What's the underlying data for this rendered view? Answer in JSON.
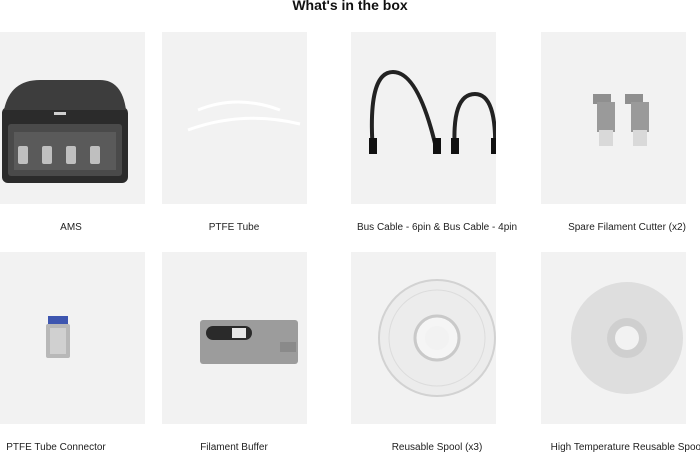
{
  "section": {
    "title": "What's in the box"
  },
  "items": [
    {
      "label": "AMS",
      "icon": "ams-unit-icon"
    },
    {
      "label": "PTFE Tube",
      "icon": "ptfe-tube-icon"
    },
    {
      "label": "Bus Cable - 6pin & Bus Cable - 4pin",
      "icon": "bus-cable-icon"
    },
    {
      "label": "Spare Filament Cutter (x2)",
      "icon": "filament-cutter-icon"
    },
    {
      "label": "PTFE Tube Connector",
      "icon": "tube-connector-icon"
    },
    {
      "label": "Filament Buffer",
      "icon": "filament-buffer-icon"
    },
    {
      "label": "Reusable Spool (x3)",
      "icon": "reusable-spool-icon"
    },
    {
      "label": "High Temperature Reusable Spool",
      "icon": "high-temp-spool-icon"
    }
  ]
}
